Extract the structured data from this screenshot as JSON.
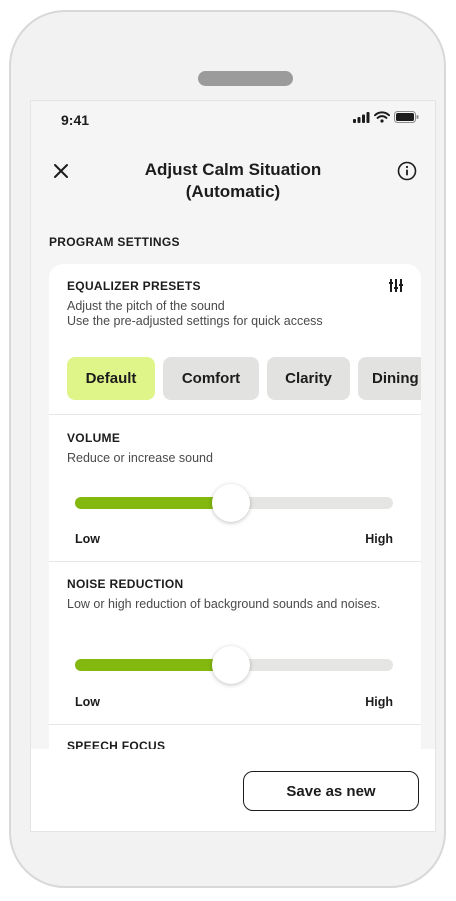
{
  "status_bar": {
    "time": "9:41"
  },
  "header": {
    "title_line1": "Adjust Calm Situation",
    "title_line2": "(Automatic)"
  },
  "program_settings": {
    "section_title": "PROGRAM SETTINGS"
  },
  "equalizer": {
    "title": "EQUALIZER PRESETS",
    "desc_line1": "Adjust the pitch of the sound",
    "desc_line2": "Use the pre-adjusted settings for quick access",
    "presets": [
      "Default",
      "Comfort",
      "Clarity",
      "Dining"
    ],
    "selected_preset": "Default"
  },
  "volume": {
    "title": "VOLUME",
    "desc": "Reduce or increase sound",
    "low_label": "Low",
    "high_label": "High",
    "level_percent": 49
  },
  "noise_reduction": {
    "title": "NOISE REDUCTION",
    "desc": "Low or high reduction of background sounds and noises.",
    "low_label": "Low",
    "high_label": "High",
    "level_percent": 49
  },
  "speech_focus": {
    "title": "SPEECH FOCUS"
  },
  "footer": {
    "save_label": "Save as new"
  },
  "colors": {
    "accent_green": "#83b80e",
    "chip_selected": "#dff58a",
    "chip_default": "#e2e2e0",
    "track": "#e5e5e3"
  },
  "icons": {
    "close": "close-icon",
    "info": "info-icon",
    "equalizer": "equalizer-icon",
    "signal": "signal-icon",
    "wifi": "wifi-icon",
    "battery": "battery-icon"
  }
}
